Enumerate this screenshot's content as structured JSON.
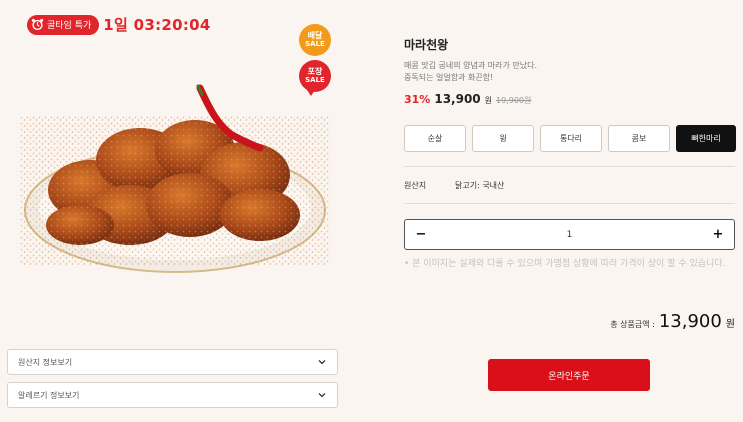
{
  "timer": {
    "badge_label": "골타임 특가",
    "countdown": "1일 03:20:04"
  },
  "badges": {
    "delivery_line1": "배달",
    "delivery_line2": "SALE",
    "pickup_line1": "포장",
    "pickup_line2": "SALE"
  },
  "product": {
    "name": "마라천왕",
    "description": "매콤 맛깁 굽네의 양념과 마라가 만났다.\n중독되는 얼얼함과 화끈함!",
    "discount": "31%",
    "price": "13,900",
    "price_unit": "원",
    "original_price": "19,900원"
  },
  "options": [
    "순살",
    "윙",
    "통다리",
    "콤보",
    "뼈한마리"
  ],
  "origin": {
    "label": "원산지",
    "value": "닭고기: 국내산"
  },
  "quantity": {
    "minus": "−",
    "value": "1",
    "plus": "+"
  },
  "notice": "• 본 이미지는 실제와 다를 수 있으며 가맹점 상황에 따라 가격이 상이 할 수 있습니다.",
  "total": {
    "label": "총 상품금액 :",
    "price": "13,900",
    "unit": "원"
  },
  "order_button": "온라인주문",
  "accordions": [
    "원산지 정보보기",
    "알레르기 정보보기"
  ],
  "colors": {
    "accent_red": "#e0262c",
    "delivery_orange": "#f29a1a",
    "background": "#faf5f0"
  }
}
